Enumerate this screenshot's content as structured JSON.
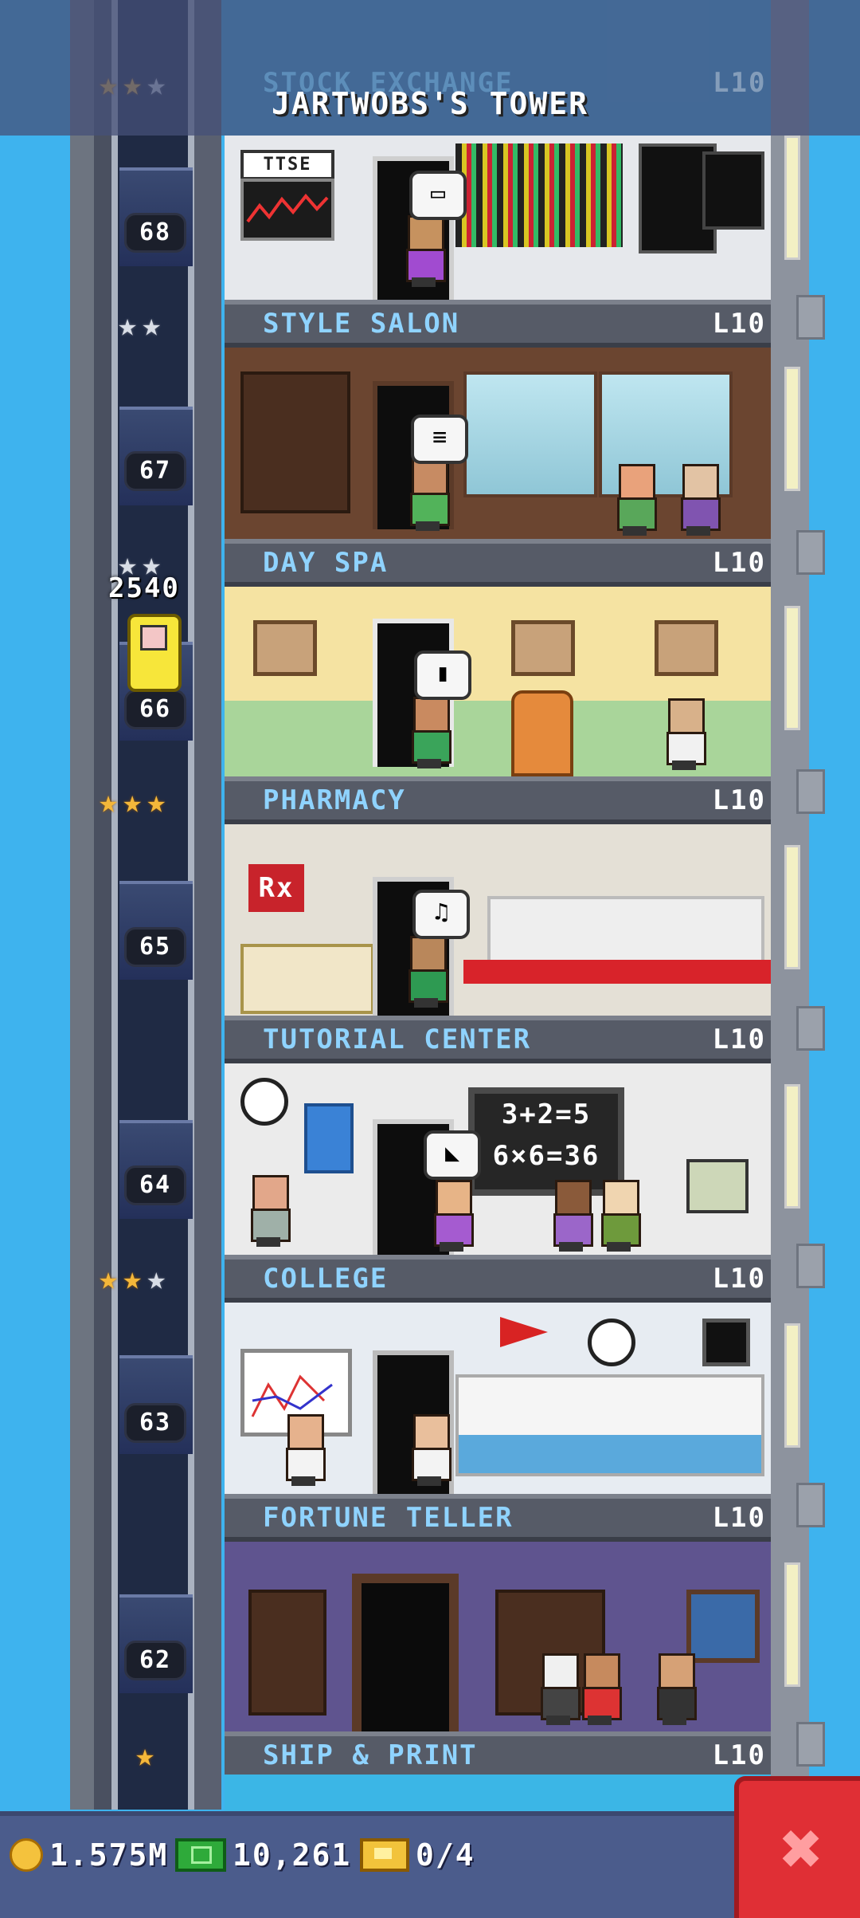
{
  "header": {
    "tower_title": "JARTWOBS'S TOWER",
    "ghost_floor": {
      "name": "STOCK EXCHANGE",
      "level": "L10"
    }
  },
  "elevator": {
    "passenger_count": "2540"
  },
  "floors": [
    {
      "number": "68",
      "name": "STYLE SALON",
      "level": "L10",
      "stars": [
        "gold",
        "gold",
        "silver"
      ],
      "sign": "TTSE",
      "bubble": "card"
    },
    {
      "number": "67",
      "name": "DAY SPA",
      "level": "L10",
      "stars": [
        "silver",
        "silver"
      ],
      "bubble": "coins"
    },
    {
      "number": "66",
      "name": "PHARMACY",
      "level": "L10",
      "stars": [
        "silver",
        "silver"
      ],
      "bubble": "bottle"
    },
    {
      "number": "65",
      "name": "TUTORIAL CENTER",
      "level": "L10",
      "stars": [
        "gold",
        "gold",
        "gold"
      ],
      "sign": "Rx",
      "bubble": "music"
    },
    {
      "number": "64",
      "name": "COLLEGE",
      "level": "L10",
      "stars": [],
      "chalk_line1": "3+2=5",
      "chalk_line2": "6×6=36",
      "bubble": "ruler"
    },
    {
      "number": "63",
      "name": "FORTUNE TELLER",
      "level": "L10",
      "stars": [
        "gold",
        "gold",
        "silver"
      ]
    },
    {
      "number": "62",
      "name": "SHIP & PRINT",
      "level": "L10",
      "stars": [
        "gold"
      ]
    }
  ],
  "resources": {
    "coins": "1.575M",
    "bux": "10,261",
    "tickets": "0/4"
  },
  "colors": {
    "sky": "#3eb3ee",
    "floor_name": "#8fd3ff",
    "close_button": "#e02f35",
    "bottom_bar": "#4b5c8c"
  },
  "icons": {
    "coin": "coin-icon",
    "bux": "cash-icon",
    "tickets": "ticket-icon",
    "close": "close-icon"
  }
}
